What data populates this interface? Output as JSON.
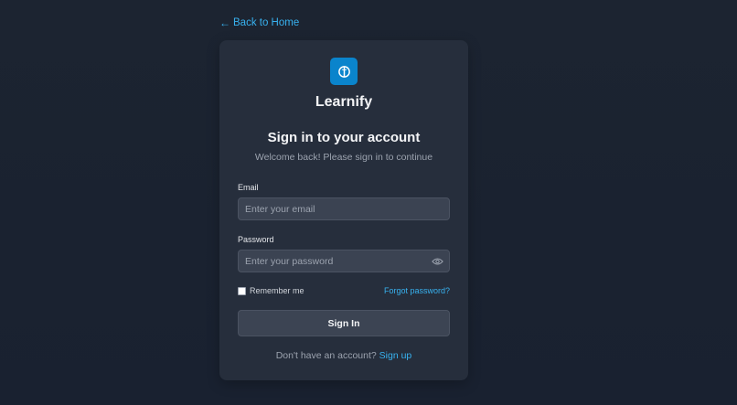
{
  "nav": {
    "back_arrow": "←",
    "back_label": "Back to Home"
  },
  "brand": {
    "name": "Learnify",
    "logo_icon": "book-icon",
    "logo_color": "#0a84cc"
  },
  "form": {
    "heading": "Sign in to your account",
    "subheading": "Welcome back! Please sign in to continue",
    "email_label": "Email",
    "email_value": "",
    "email_placeholder": "Enter your email",
    "password_label": "Password",
    "password_value": "",
    "password_placeholder": "Enter your password",
    "password_toggle_icon": "eye-icon",
    "remember_label": "Remember me",
    "remember_checked": false,
    "forgot_label": "Forgot password?",
    "submit_label": "Sign In",
    "signup_prompt": "Don't have an account?",
    "signup_label": "Sign up"
  },
  "colors": {
    "accent": "#38b2f0",
    "background": "#1c2431",
    "card": "#262e3c",
    "input": "#3b4352"
  }
}
